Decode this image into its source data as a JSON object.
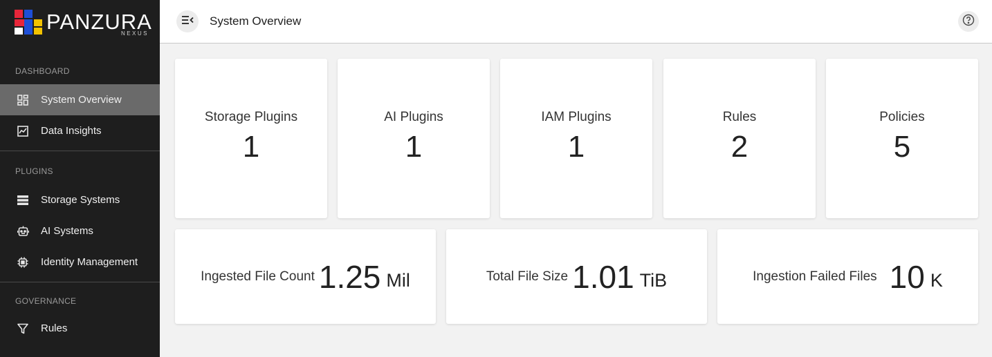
{
  "brand": {
    "name": "PANZURA",
    "sub": "NEXUS"
  },
  "sidebar": {
    "sections": [
      {
        "label": "DASHBOARD",
        "items": [
          {
            "label": "System Overview",
            "icon": "dashboard-grid-icon",
            "active": true
          },
          {
            "label": "Data Insights",
            "icon": "chart-icon",
            "active": false
          }
        ]
      },
      {
        "label": "PLUGINS",
        "items": [
          {
            "label": "Storage Systems",
            "icon": "storage-list-icon",
            "active": false
          },
          {
            "label": "AI Systems",
            "icon": "robot-icon",
            "active": false
          },
          {
            "label": "Identity Management",
            "icon": "chip-icon",
            "active": false
          }
        ]
      },
      {
        "label": "GOVERNANCE",
        "items": [
          {
            "label": "Rules",
            "icon": "filter-icon",
            "active": false
          }
        ]
      }
    ]
  },
  "header": {
    "title": "System Overview",
    "menu_icon": "menu-collapse-icon",
    "help_icon": "help-icon"
  },
  "stats": [
    {
      "label": "Storage Plugins",
      "value": "1"
    },
    {
      "label": "AI Plugins",
      "value": "1"
    },
    {
      "label": "IAM Plugins",
      "value": "1"
    },
    {
      "label": "Rules",
      "value": "2"
    },
    {
      "label": "Policies",
      "value": "5"
    }
  ],
  "metrics": [
    {
      "label": "Ingested File Count",
      "value": "1.25",
      "unit": "Mil"
    },
    {
      "label": "Total File Size",
      "value": "1.01",
      "unit": "TiB"
    },
    {
      "label": "Ingestion Failed Files",
      "value": "10",
      "unit": "K"
    }
  ],
  "colors": {
    "sidebar_bg": "#1e1e1e",
    "active_item": "#6a6a6a",
    "logo_red": "#e8263a",
    "logo_blue": "#1e4fd6",
    "logo_yellow": "#f2c200"
  }
}
